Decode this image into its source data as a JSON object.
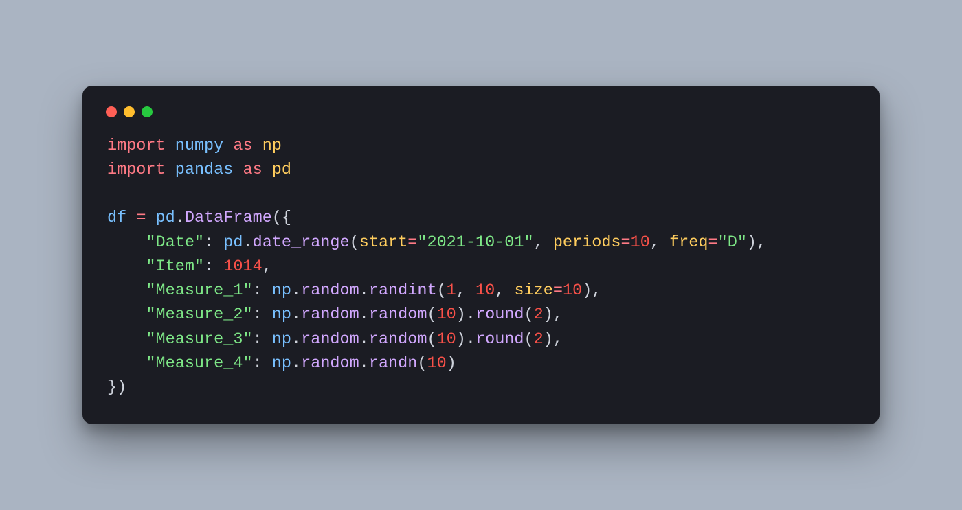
{
  "colors": {
    "background": "#aab4c2",
    "window_bg": "#1b1c23",
    "dot_red": "#ff5f56",
    "dot_yellow": "#ffbd2e",
    "dot_green": "#27c93f",
    "keyword": "#ff7a85",
    "module": "#79c0ff",
    "alias": "#ffcd5e",
    "attr": "#d2a8ff",
    "string": "#7ee787",
    "number": "#f85149",
    "param": "#ffcd5e",
    "default": "#cfd3dc"
  },
  "code": {
    "lines": [
      [
        {
          "cls": "kw",
          "t": "import"
        },
        {
          "cls": "pun",
          "t": " "
        },
        {
          "cls": "mod",
          "t": "numpy"
        },
        {
          "cls": "pun",
          "t": " "
        },
        {
          "cls": "kw",
          "t": "as"
        },
        {
          "cls": "pun",
          "t": " "
        },
        {
          "cls": "alias",
          "t": "np"
        }
      ],
      [
        {
          "cls": "kw",
          "t": "import"
        },
        {
          "cls": "pun",
          "t": " "
        },
        {
          "cls": "mod",
          "t": "pandas"
        },
        {
          "cls": "pun",
          "t": " "
        },
        {
          "cls": "kw",
          "t": "as"
        },
        {
          "cls": "pun",
          "t": " "
        },
        {
          "cls": "alias",
          "t": "pd"
        }
      ],
      [],
      [
        {
          "cls": "var",
          "t": "df"
        },
        {
          "cls": "pun",
          "t": " "
        },
        {
          "cls": "op",
          "t": "="
        },
        {
          "cls": "pun",
          "t": " "
        },
        {
          "cls": "mod",
          "t": "pd"
        },
        {
          "cls": "pun",
          "t": "."
        },
        {
          "cls": "attr",
          "t": "DataFrame"
        },
        {
          "cls": "pun",
          "t": "({"
        }
      ],
      [
        {
          "cls": "pun",
          "t": "    "
        },
        {
          "cls": "str",
          "t": "\"Date\""
        },
        {
          "cls": "pun",
          "t": ": "
        },
        {
          "cls": "mod",
          "t": "pd"
        },
        {
          "cls": "pun",
          "t": "."
        },
        {
          "cls": "attr",
          "t": "date_range"
        },
        {
          "cls": "pun",
          "t": "("
        },
        {
          "cls": "param",
          "t": "start"
        },
        {
          "cls": "op",
          "t": "="
        },
        {
          "cls": "str",
          "t": "\"2021-10-01\""
        },
        {
          "cls": "pun",
          "t": ", "
        },
        {
          "cls": "param",
          "t": "periods"
        },
        {
          "cls": "op",
          "t": "="
        },
        {
          "cls": "num",
          "t": "10"
        },
        {
          "cls": "pun",
          "t": ", "
        },
        {
          "cls": "param",
          "t": "freq"
        },
        {
          "cls": "op",
          "t": "="
        },
        {
          "cls": "str",
          "t": "\"D\""
        },
        {
          "cls": "pun",
          "t": "),"
        }
      ],
      [
        {
          "cls": "pun",
          "t": "    "
        },
        {
          "cls": "str",
          "t": "\"Item\""
        },
        {
          "cls": "pun",
          "t": ": "
        },
        {
          "cls": "num",
          "t": "1014"
        },
        {
          "cls": "pun",
          "t": ","
        }
      ],
      [
        {
          "cls": "pun",
          "t": "    "
        },
        {
          "cls": "str",
          "t": "\"Measure_1\""
        },
        {
          "cls": "pun",
          "t": ": "
        },
        {
          "cls": "mod",
          "t": "np"
        },
        {
          "cls": "pun",
          "t": "."
        },
        {
          "cls": "attr",
          "t": "random"
        },
        {
          "cls": "pun",
          "t": "."
        },
        {
          "cls": "attr",
          "t": "randint"
        },
        {
          "cls": "pun",
          "t": "("
        },
        {
          "cls": "num",
          "t": "1"
        },
        {
          "cls": "pun",
          "t": ", "
        },
        {
          "cls": "num",
          "t": "10"
        },
        {
          "cls": "pun",
          "t": ", "
        },
        {
          "cls": "param",
          "t": "size"
        },
        {
          "cls": "op",
          "t": "="
        },
        {
          "cls": "num",
          "t": "10"
        },
        {
          "cls": "pun",
          "t": "),"
        }
      ],
      [
        {
          "cls": "pun",
          "t": "    "
        },
        {
          "cls": "str",
          "t": "\"Measure_2\""
        },
        {
          "cls": "pun",
          "t": ": "
        },
        {
          "cls": "mod",
          "t": "np"
        },
        {
          "cls": "pun",
          "t": "."
        },
        {
          "cls": "attr",
          "t": "random"
        },
        {
          "cls": "pun",
          "t": "."
        },
        {
          "cls": "attr",
          "t": "random"
        },
        {
          "cls": "pun",
          "t": "("
        },
        {
          "cls": "num",
          "t": "10"
        },
        {
          "cls": "pun",
          "t": ")."
        },
        {
          "cls": "attr",
          "t": "round"
        },
        {
          "cls": "pun",
          "t": "("
        },
        {
          "cls": "num",
          "t": "2"
        },
        {
          "cls": "pun",
          "t": "),"
        }
      ],
      [
        {
          "cls": "pun",
          "t": "    "
        },
        {
          "cls": "str",
          "t": "\"Measure_3\""
        },
        {
          "cls": "pun",
          "t": ": "
        },
        {
          "cls": "mod",
          "t": "np"
        },
        {
          "cls": "pun",
          "t": "."
        },
        {
          "cls": "attr",
          "t": "random"
        },
        {
          "cls": "pun",
          "t": "."
        },
        {
          "cls": "attr",
          "t": "random"
        },
        {
          "cls": "pun",
          "t": "("
        },
        {
          "cls": "num",
          "t": "10"
        },
        {
          "cls": "pun",
          "t": ")."
        },
        {
          "cls": "attr",
          "t": "round"
        },
        {
          "cls": "pun",
          "t": "("
        },
        {
          "cls": "num",
          "t": "2"
        },
        {
          "cls": "pun",
          "t": "),"
        }
      ],
      [
        {
          "cls": "pun",
          "t": "    "
        },
        {
          "cls": "str",
          "t": "\"Measure_4\""
        },
        {
          "cls": "pun",
          "t": ": "
        },
        {
          "cls": "mod",
          "t": "np"
        },
        {
          "cls": "pun",
          "t": "."
        },
        {
          "cls": "attr",
          "t": "random"
        },
        {
          "cls": "pun",
          "t": "."
        },
        {
          "cls": "attr",
          "t": "randn"
        },
        {
          "cls": "pun",
          "t": "("
        },
        {
          "cls": "num",
          "t": "10"
        },
        {
          "cls": "pun",
          "t": ")"
        }
      ],
      [
        {
          "cls": "pun",
          "t": "})"
        }
      ]
    ]
  }
}
